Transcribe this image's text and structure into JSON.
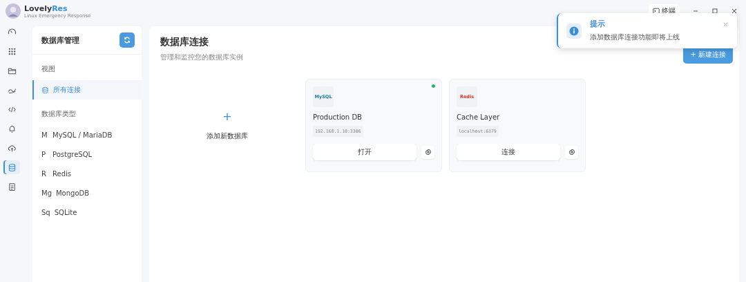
{
  "app": {
    "name": "Lovely",
    "name_accent": "Res",
    "subtitle": "Linux Emergency Response"
  },
  "titlebar": {
    "terminal_button": "终端"
  },
  "rail": [
    {
      "kind": "gauge",
      "selected": false
    },
    {
      "kind": "grid",
      "selected": false
    },
    {
      "kind": "folder",
      "selected": false
    },
    {
      "kind": "wave",
      "selected": false
    },
    {
      "kind": "code",
      "selected": false
    },
    {
      "kind": "bell",
      "selected": false
    },
    {
      "kind": "cloud",
      "selected": false
    },
    {
      "kind": "database",
      "selected": true
    },
    {
      "kind": "document",
      "selected": false
    }
  ],
  "sidebar": {
    "title": "数据库管理",
    "sections": [
      {
        "heading": "视图",
        "items": [
          {
            "kind": "icon",
            "label": "所有连接",
            "selected": true
          }
        ]
      },
      {
        "heading": "数据库类型",
        "items": [
          {
            "kind": "prefix",
            "prefix": "M",
            "label": "MySQL / MariaDB",
            "selected": false
          },
          {
            "kind": "prefix",
            "prefix": "P",
            "label": "PostgreSQL",
            "selected": false
          },
          {
            "kind": "prefix",
            "prefix": "R",
            "label": "Redis",
            "selected": false
          },
          {
            "kind": "prefix",
            "prefix": "Mg",
            "label": "MongoDB",
            "selected": false
          },
          {
            "kind": "prefix",
            "prefix": "Sq",
            "label": "SQLite",
            "selected": false
          }
        ]
      }
    ]
  },
  "main": {
    "title": "数据库连接",
    "subtitle": "管理和监控您的数据库实例",
    "new_button": "+ 新建连接",
    "add_card": {
      "icon": "+",
      "label": "添加新数据库"
    },
    "connections": [
      {
        "badge": "MySQL",
        "color": "#1f7a9c",
        "name": "Production DB",
        "address": "192.168.1.10:3306",
        "online": true,
        "action": "打开"
      },
      {
        "badge": "Redis",
        "color": "#d8332c",
        "name": "Cache Layer",
        "address": "localhost:6379",
        "online": false,
        "action": "连接"
      }
    ]
  },
  "toast": {
    "title": "提示",
    "message": "添加数据库连接功能即将上线"
  }
}
